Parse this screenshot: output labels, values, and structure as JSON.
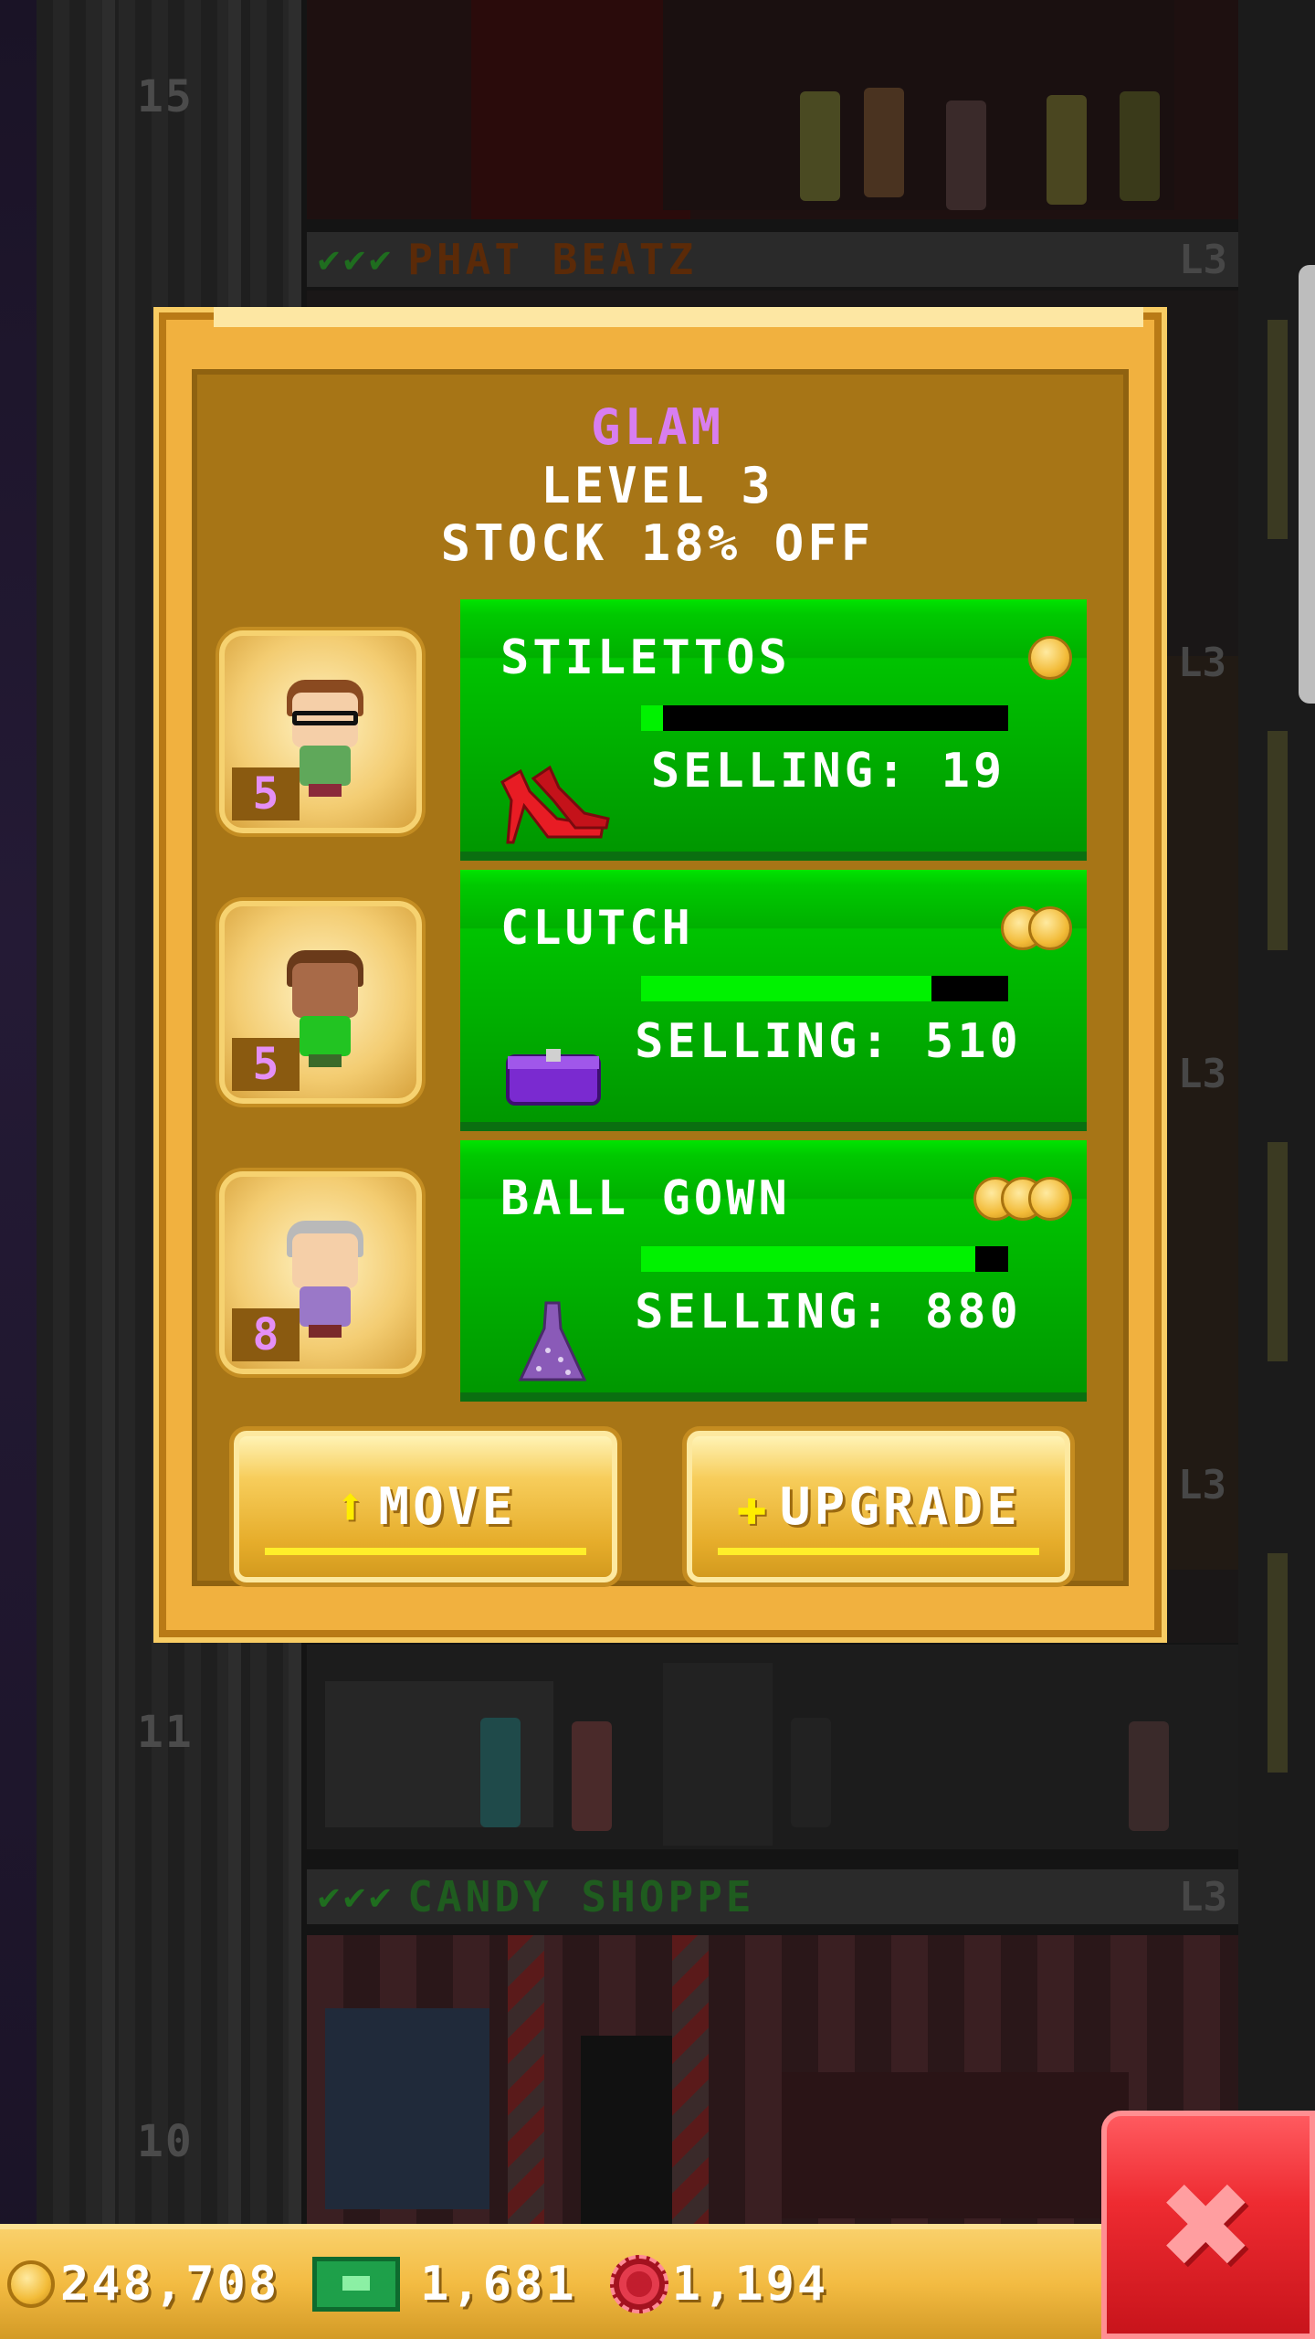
{
  "tower": {
    "floors": [
      {
        "number": "15"
      },
      {
        "number": "11"
      },
      {
        "number": "10"
      }
    ],
    "bars": [
      {
        "checks": "✔✔✔",
        "name": "PHAT BEATZ",
        "level": "L3"
      },
      {
        "checks": "✔✔✔",
        "name": "CANDY SHOPPE",
        "level": "L3"
      }
    ],
    "side_levels": [
      "L3",
      "L3",
      "L3",
      "L3"
    ]
  },
  "dialog": {
    "title": "GLAM",
    "level": "LEVEL 3",
    "stock": "STOCK 18% OFF",
    "title_color": "#d87ef0",
    "products": [
      {
        "name": "STILETTOS",
        "selling": "SELLING: 19",
        "progress": 0.06,
        "coins": 1,
        "icon": "stiletto-icon",
        "worker_skill": "5",
        "worker_shirt": "#5fa85a",
        "worker_hair": "#8a4a20"
      },
      {
        "name": "CLUTCH",
        "selling": "SELLING: 510",
        "progress": 0.79,
        "coins": 2,
        "icon": "clutch-icon",
        "worker_skill": "5",
        "worker_shirt": "#22c422",
        "worker_hair": "#6a3a1a"
      },
      {
        "name": "BALL GOWN",
        "selling": "SELLING: 880",
        "progress": 0.91,
        "coins": 3,
        "icon": "ball-gown-icon",
        "worker_skill": "8",
        "worker_shirt": "#9a78c8",
        "worker_hair": "#b9b9b9"
      }
    ],
    "buttons": {
      "move": "MOVE",
      "upgrade": "UPGRADE"
    }
  },
  "currency": {
    "coins": "248,708",
    "bux": "1,681",
    "chips": "1,194"
  },
  "colors": {
    "panel": "#f1b13f",
    "panel_inner": "#a77516",
    "product_green": "#00b000",
    "close_red": "#ee2b31"
  }
}
